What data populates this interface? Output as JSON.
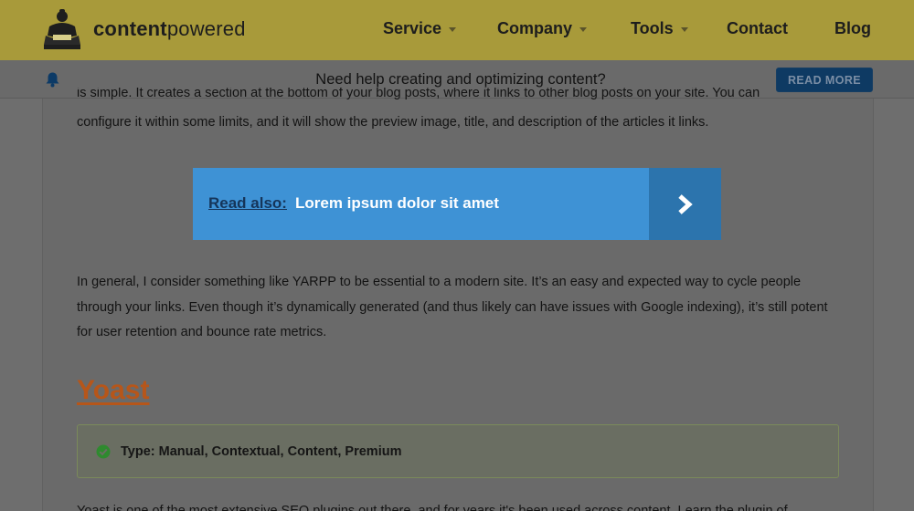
{
  "header": {
    "brand_bold": "content",
    "brand_light": "powered",
    "nav": [
      {
        "label": "Service",
        "has_dropdown": true
      },
      {
        "label": "Company",
        "has_dropdown": true
      },
      {
        "label": "Tools",
        "has_dropdown": true
      },
      {
        "label": "Contact",
        "has_dropdown": false
      },
      {
        "label": "Blog",
        "has_dropdown": false
      }
    ]
  },
  "notice": {
    "icon": "bell-icon",
    "text": "Need help creating and optimizing content?",
    "button_label": "READ MORE"
  },
  "article": {
    "intro_cut": "is simple. It creates a section at the bottom of your blog posts, where it links to other blog posts on your site. You can",
    "intro_rest": "configure it within some limits, and it will show the preview image, title, and description of the articles it links.",
    "read_also": {
      "label": "Read also:",
      "title": "Lorem ipsum dolor sit amet",
      "icon": "chevron-right-icon"
    },
    "paragraph_yarpp": "In general, I consider something like YARPP to be essential to a modern site. It’s an easy and expected way to cycle people through your links. Even though it’s dynamically generated (and thus likely can have issues with Google indexing), it’s still potent for user retention and bounce rate metrics.",
    "section_heading": "Yoast",
    "type_box": {
      "icon": "check-circle-icon",
      "text": "Type: Manual, Contextual, Content, Premium"
    },
    "bottom_cut": "Yoast is one of the most extensive SEO plugins out there, and for years it's been used across content. Learn the plugin of"
  },
  "colors": {
    "header_bg": "#a89a3a",
    "overlay_bg": "#6a6a6a",
    "read_also_bg": "#3e92d5",
    "read_also_arrow_bg": "#2c74ad",
    "heading_orange": "#b6561a",
    "button_blue": "#0e3a63"
  }
}
